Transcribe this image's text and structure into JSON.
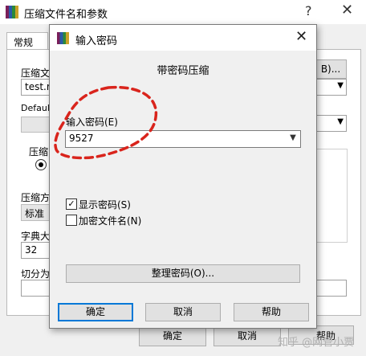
{
  "background_window": {
    "title": "压缩文件名和参数",
    "help_glyph": "?",
    "close_glyph": "✕",
    "tab_general": "常规",
    "archive_name_label": "压缩文",
    "archive_name_value": "test.ra",
    "browse_button": "B)...",
    "default_profile_label": "Default",
    "compress_format_label": "压缩",
    "compress_method_label": "压缩方",
    "compress_method_value": "标准",
    "dict_size_label": "字典大",
    "dict_size_value": "32",
    "split_label": "切分为",
    "ok_button": "确定",
    "cancel_button": "取消",
    "help_button": "帮助"
  },
  "dialog": {
    "title": "输入密码",
    "close_glyph": "✕",
    "heading": "带密码压缩",
    "password_label": "输入密码(E)",
    "password_value": "9527",
    "show_password_label": "显示密码(S)",
    "show_password_checked": true,
    "encrypt_filenames_label": "加密文件名(N)",
    "encrypt_filenames_checked": false,
    "organize_button": "整理密码(O)...",
    "ok_button": "确定",
    "cancel_button": "取消",
    "help_button": "帮助"
  },
  "watermark": "知乎 @网管小贾",
  "colors": {
    "annotation": "#d9241c",
    "default_button_border": "#0078d7"
  }
}
